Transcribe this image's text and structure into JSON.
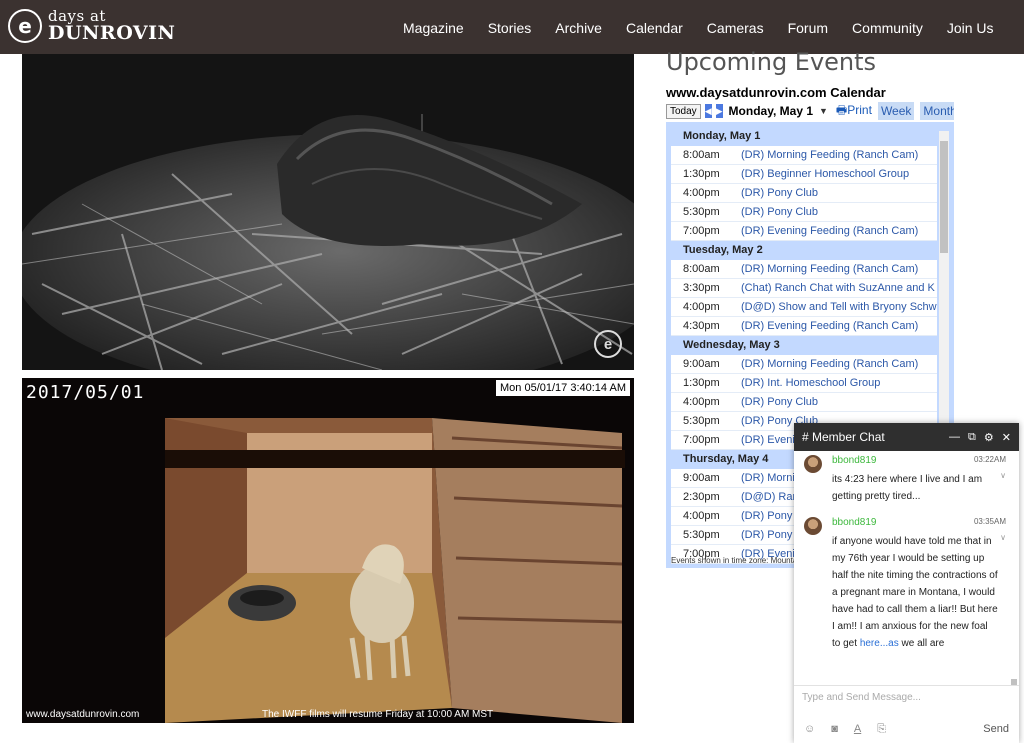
{
  "header": {
    "logo_top": "days at",
    "logo_bottom": "DUNROVIN",
    "nav": [
      "Magazine",
      "Stories",
      "Archive",
      "Calendar",
      "Cameras",
      "Forum",
      "Community",
      "Join Us"
    ]
  },
  "cameras": {
    "bottom_date": "2017/05/01",
    "bottom_stamp": "Mon 05/01/17 3:40:14 AM",
    "bottom_site": "www.daysatdunrovin.com",
    "bottom_notice": "The IWFF films will resume Friday at 10:00 AM MST"
  },
  "events": {
    "heading": "Upcoming Events",
    "calendar_title": "www.daysatdunrovin.com Calendar",
    "toolbar": {
      "today": "Today",
      "date": "Monday, May 1",
      "print": "Print",
      "tab_week": "Week",
      "tab_month": "Month"
    },
    "days": [
      {
        "label": "Monday, May 1",
        "events": [
          {
            "time": "8:00am",
            "title": "(DR) Morning Feeding (Ranch Cam)"
          },
          {
            "time": "1:30pm",
            "title": "(DR) Beginner Homeschool Group"
          },
          {
            "time": "4:00pm",
            "title": "(DR) Pony Club"
          },
          {
            "time": "5:30pm",
            "title": "(DR) Pony Club"
          },
          {
            "time": "7:00pm",
            "title": "(DR) Evening Feeding (Ranch Cam)"
          }
        ]
      },
      {
        "label": "Tuesday, May 2",
        "events": [
          {
            "time": "8:00am",
            "title": "(DR) Morning Feeding (Ranch Cam)"
          },
          {
            "time": "3:30pm",
            "title": "(Chat) Ranch Chat with SuzAnne and K"
          },
          {
            "time": "4:00pm",
            "title": "(D@D) Show and Tell with Bryony Schw"
          },
          {
            "time": "4:30pm",
            "title": "(DR) Evening Feeding (Ranch Cam)"
          }
        ]
      },
      {
        "label": "Wednesday, May 3",
        "events": [
          {
            "time": "9:00am",
            "title": "(DR) Morning Feeding (Ranch Cam)"
          },
          {
            "time": "1:30pm",
            "title": "(DR) Int. Homeschool Group"
          },
          {
            "time": "4:00pm",
            "title": "(DR) Pony Club"
          },
          {
            "time": "5:30pm",
            "title": "(DR) Pony Club"
          },
          {
            "time": "7:00pm",
            "title": "(DR) Evening Feeding (Ranch Cam)"
          }
        ]
      },
      {
        "label": "Thursday, May 4",
        "events": [
          {
            "time": "9:00am",
            "title": "(DR) Morning Feeding (Ranch Cam)"
          },
          {
            "time": "2:30pm",
            "title": "(D@D) Ranch Chat"
          },
          {
            "time": "4:00pm",
            "title": "(DR) Pony Club"
          },
          {
            "time": "5:30pm",
            "title": "(DR) Pony Club"
          },
          {
            "time": "7:00pm",
            "title": "(DR) Evening Feeding"
          }
        ]
      }
    ],
    "footer": "Events shown in time zone: Mountain Time"
  },
  "chat": {
    "title": "Member Chat",
    "messages": [
      {
        "user": "bbond819",
        "time": "03:22AM",
        "text": "its 4:23 here where I live and I am getting pretty tired..."
      },
      {
        "user": "bbond819",
        "time": "03:35AM",
        "text": "if anyone would have told me that in my 76th year I would be setting up half the nite timing the contractions of a pregnant mare in Montana, I would have had to call them a liar!! But here I am!! I am anxious for the new foal to get",
        "link": "here...as",
        "tail": " we all are"
      }
    ],
    "input_placeholder": "Type and Send Message...",
    "send": "Send"
  },
  "colors": {
    "header_bg": "#3b3230",
    "calendar_bg": "#c3d9ff",
    "chat_user": "#3db83d",
    "link": "#2c58a8"
  }
}
